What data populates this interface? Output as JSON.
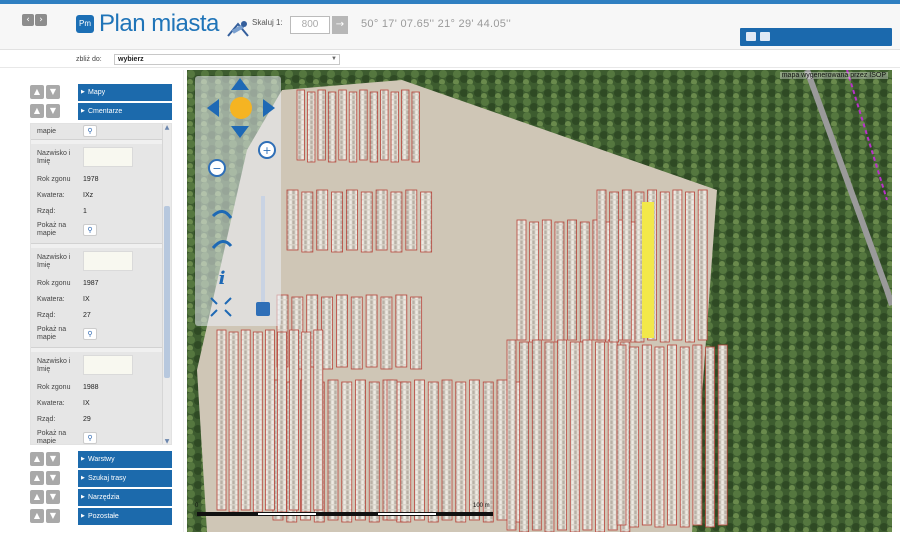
{
  "header": {
    "logo_badge": "Pm",
    "title": "Plan miasta",
    "scale_label": "Skaluj 1:",
    "scale_value": "800",
    "scale_go": "→",
    "coordinates": "50° 17' 07.65'' 21° 29' 44.05''"
  },
  "zoom": {
    "label": "zbliż do:",
    "selected": "wybierz"
  },
  "sidebar": {
    "panels_top": [
      "Mapy",
      "Cmentarze"
    ],
    "panels_bottom": [
      "Warstwy",
      "Szukaj trasy",
      "Narzędzia",
      "Pozostałe"
    ],
    "results": [
      {
        "name_label": "Nazwisko i Imię",
        "year_label": "Rok zgonu",
        "year": "1978",
        "section_label": "Kwatera:",
        "section": "IXz",
        "row_label": "Rząd:",
        "row": "1",
        "show_label": "Pokaż na mapie"
      },
      {
        "name_label": "Nazwisko i Imię",
        "year_label": "Rok zgonu",
        "year": "1987",
        "section_label": "Kwatera:",
        "section": "IX",
        "row_label": "Rząd:",
        "row": "27",
        "show_label": "Pokaż na mapie"
      },
      {
        "name_label": "Nazwisko i Imię",
        "year_label": "Rok zgonu",
        "year": "1988",
        "section_label": "Kwatera:",
        "section": "IX",
        "row_label": "Rząd:",
        "row": "29",
        "show_label": "Pokaż na mapie"
      }
    ],
    "partial_top_label": "mapie"
  },
  "map": {
    "attribution": "mapa wygenerowana przez ISOP",
    "scale_labels": [
      "0",
      "100 m"
    ],
    "highlight_color": "#f2e84a",
    "grid_color": "#b8443a"
  }
}
